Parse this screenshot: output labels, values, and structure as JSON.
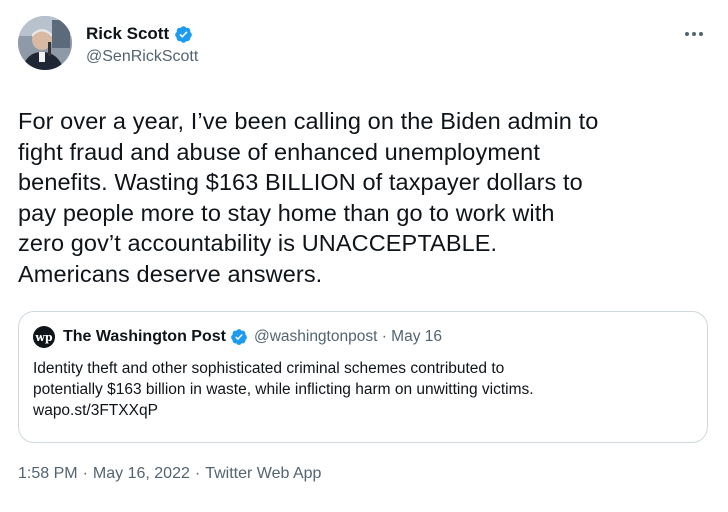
{
  "author": {
    "name": "Rick Scott",
    "handle": "@SenRickScott"
  },
  "tweet": {
    "text": "For over a year, I’ve been calling on the Biden admin to\nfight fraud and abuse of enhanced unemployment\nbenefits. Wasting $163 BILLION of taxpayer dollars to\npay people more to stay home than go to work with\nzero gov’t accountability is UNACCEPTABLE.\nAmericans deserve answers."
  },
  "quote": {
    "logo_text": "wp",
    "name": "The Washington Post",
    "meta": "@washingtonpost · May 16",
    "text": "Identity theft and other sophisticated criminal schemes contributed to\npotentially $163 billion in waste, while inflicting harm on unwitting victims.\nwapo.st/3FTXXqP"
  },
  "footer": {
    "time": "1:58 PM",
    "separator": "·",
    "date": "May 16, 2022",
    "source": "Twitter Web App"
  },
  "colors": {
    "verified_blue": "#1d9bf0",
    "secondary_text": "#536471",
    "border": "#cfd9de"
  },
  "icons": {
    "verified": "verified-badge-icon",
    "more": "more-horizontal-icon"
  }
}
